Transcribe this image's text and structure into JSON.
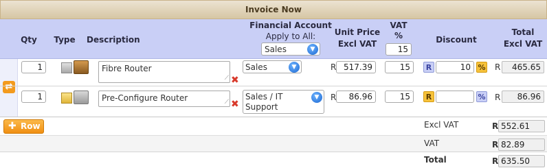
{
  "title": "Invoice Now",
  "headers": {
    "qty": "Qty",
    "type": "Type",
    "description": "Description",
    "financial_account": "Financial Account",
    "apply_to_all": "Apply to All:",
    "unit_price_line1": "Unit Price",
    "unit_price_line2": "Excl VAT",
    "vat_line1": "VAT",
    "vat_line2": "%",
    "discount": "Discount",
    "total_line1": "Total",
    "total_line2": "Excl VAT"
  },
  "apply_all": {
    "account": "Sales",
    "vat": "15"
  },
  "currency": "R",
  "rows": [
    {
      "qty": "1",
      "description": "Fibre Router",
      "account": "Sales",
      "unit_price": "517.39",
      "vat": "15",
      "discount_type": "R",
      "discount_value": "10",
      "discount_pct": "%",
      "total": "465.65"
    },
    {
      "qty": "1",
      "description": "Pre-Configure Router",
      "account_line1": "Sales / IT",
      "account_line2": "Support",
      "unit_price": "86.96",
      "vat": "15",
      "discount_type": "R",
      "discount_value": "",
      "discount_pct": "%",
      "total": "86.96"
    }
  ],
  "add_row_label": "Row",
  "totals": {
    "excl_vat_label": "Excl VAT",
    "excl_vat": "552.61",
    "vat_label": "VAT",
    "vat": "82.89",
    "total_label": "Total",
    "total": "635.50"
  },
  "colors": {
    "header_bg": "#c9cff6",
    "accent_orange": "#f6a623",
    "select_blue": "#1a66d1",
    "remove_red": "#d8392b"
  }
}
